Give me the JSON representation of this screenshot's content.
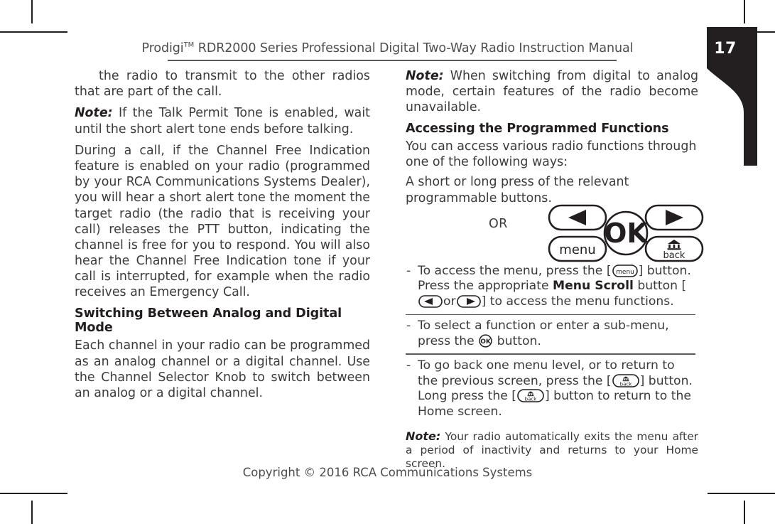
{
  "page": {
    "number": "17",
    "running_head_prefix": "Prodigi",
    "running_head_superscript": "TM",
    "running_head_rest": " RDR2000 Series Professional Digital Two-Way Radio Instruction Manual",
    "footer": "Copyright © 2016 RCA Communications Systems",
    "tab_color": "#231f20",
    "text_color": "#3c3b3c",
    "heading_color": "#231f20",
    "rule_color": "#58595b"
  },
  "left_column": {
    "para_continued": "the radio to transmit to the other radios that are part of the call.",
    "note1_label": "Note:",
    "note1_text": " If the Talk Permit Tone is enabled, wait until the short alert tone ends before talking.",
    "para_channel_free": "During a call, if the Channel Free Indication feature is enabled on your radio (programmed by your RCA Communications Systems Dealer), you will hear a short alert tone the moment the target radio (the radio that is receiving your call) releases the PTT button, indicating the channel is free for you to respond. You will also hear the Channel Free Indication tone if your call is interrupted, for example when the radio receives an Emergency Call.",
    "heading_switching": "Switching Between Analog and Digital Mode",
    "para_each_channel": "Each channel in your radio can be programmed as an analog channel or a digital channel. Use the Channel Selector Knob to switch between an analog or a digital channel."
  },
  "right_column": {
    "note2_label": "Note:",
    "note2_text": " When switching from digital to analog mode, certain features of the radio become unavailable.",
    "heading_accessing": "Accessing the Programmed Functions",
    "para_you_can_access": "You can access various radio functions through one of the following ways:",
    "para_short_long_press": "A short or long press of the relevant programmable buttons.",
    "or_label": "OR",
    "buttons": {
      "scroll_left": "scroll-left",
      "scroll_right": "scroll-right",
      "ok": "OK",
      "menu": "menu",
      "back": "back"
    },
    "steps": [
      {
        "dash": "-",
        "part1": "To access the menu, press the [",
        "key1": "menu",
        "part2": "] button. Press the appropriate ",
        "bold": "Menu Scroll",
        "part3": " button [",
        "key2": "scroll-left",
        "part4": "or",
        "key3": "scroll-right",
        "part5": "] to access the menu functions."
      },
      {
        "dash": "-",
        "part1": "To select a function or enter a sub-menu, press the ",
        "key1": "OK",
        "part2": " button."
      },
      {
        "dash": "-",
        "part1": "To go back one menu level, or to return to the previous screen, press the [",
        "key1": "back",
        "part2": "] button. Long press the [",
        "key2": "back",
        "part3": "] button to return to the Home screen."
      }
    ],
    "final_note_label": "Note:",
    "final_note_text": " Your radio automatically exits the menu after a period of inactivity and returns to your Home screen."
  }
}
